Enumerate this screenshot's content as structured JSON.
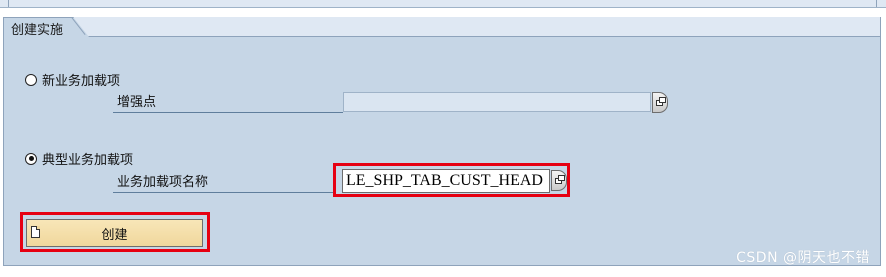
{
  "group": {
    "title": "创建实施"
  },
  "options": {
    "new_badi": {
      "label": "新业务加载项",
      "selected": false,
      "field_label": "增强点",
      "field_value": ""
    },
    "classic_badi": {
      "label": "典型业务加载项",
      "selected": true,
      "field_label": "业务加载项名称",
      "field_value": "LE_SHP_TAB_CUST_HEAD"
    }
  },
  "actions": {
    "create_label": "创建"
  },
  "icons": {
    "value_help": "value-help-icon",
    "create": "new-document-icon"
  },
  "colors": {
    "panel_bg": "#c6d6e6",
    "highlight": "#e60012",
    "button_bg": "#f0d79c"
  },
  "watermark": "CSDN @阴天也不错"
}
